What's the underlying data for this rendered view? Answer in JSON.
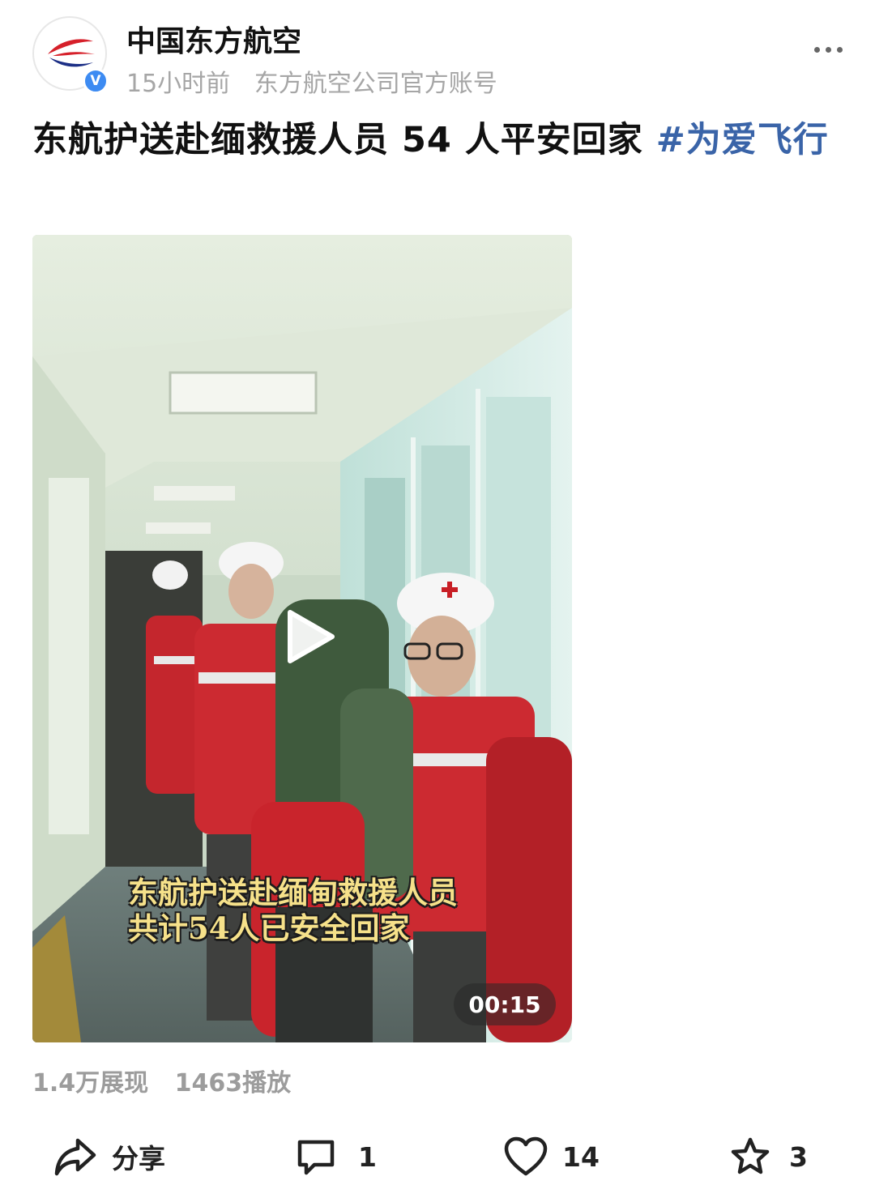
{
  "author": {
    "name": "中国东方航空",
    "time": "15小时前",
    "description": "东方航空公司官方账号",
    "verified": true,
    "logo_colors": {
      "red": "#d6202a",
      "blue": "#1c2f86"
    }
  },
  "post": {
    "title": "东航护送赴缅救援人员 54 人平安回家 ",
    "hashtag": "#为爱飞行"
  },
  "video": {
    "caption_line1": "东航护送赴缅甸救援人员",
    "caption_line2": "共计54人已安全回家",
    "duration": "00:15"
  },
  "stats": {
    "impressions": "1.4万展现",
    "plays": "1463播放"
  },
  "actions": {
    "share": {
      "label": "分享",
      "icon": "share-icon"
    },
    "comment": {
      "count": "1",
      "icon": "comment-icon"
    },
    "like": {
      "count": "14",
      "icon": "heart-icon"
    },
    "favorite": {
      "count": "3",
      "icon": "star-icon"
    }
  },
  "colors": {
    "hashtag": "#3a64a8",
    "verified_badge": "#3d8bf2",
    "caption": "#f6e18a"
  }
}
